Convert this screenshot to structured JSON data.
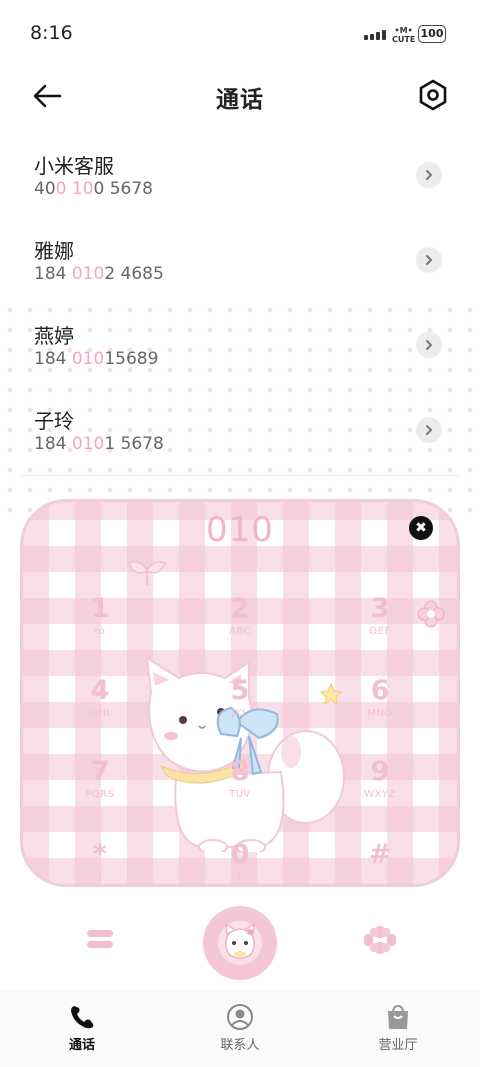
{
  "status_bar": {
    "time": "8:16",
    "carrier_badge": "•M•\nCUTE",
    "battery": "100"
  },
  "header": {
    "title": "通话",
    "back_icon": "arrow-left-icon",
    "settings_icon": "gear-hex-icon"
  },
  "calls": [
    {
      "name": "小米客服",
      "num_a": "40",
      "num_h1": "0",
      "num_b": " ",
      "num_h2": "10",
      "num_c": "0 5678"
    },
    {
      "name": "雅娜",
      "num_a": "184 ",
      "num_h1": "010",
      "num_b": "",
      "num_h2": "",
      "num_c": "2 4685"
    },
    {
      "name": "燕婷",
      "num_a": "184 ",
      "num_h1": "010",
      "num_b": "",
      "num_h2": "",
      "num_c": "15689"
    },
    {
      "name": "子玲",
      "num_a": "184 ",
      "num_h1": "010",
      "num_b": "",
      "num_h2": "",
      "num_c": "1 5678"
    }
  ],
  "dialpad": {
    "input": "010",
    "clear_icon": "close-icon",
    "keys": [
      {
        "digit": "1",
        "letters": "ꝏ"
      },
      {
        "digit": "2",
        "letters": "ABC"
      },
      {
        "digit": "3",
        "letters": "DEF"
      },
      {
        "digit": "4",
        "letters": "GHI"
      },
      {
        "digit": "5",
        "letters": "JKL"
      },
      {
        "digit": "6",
        "letters": "MNO"
      },
      {
        "digit": "7",
        "letters": "PQRS"
      },
      {
        "digit": "8",
        "letters": "TUV"
      },
      {
        "digit": "9",
        "letters": "WXYZ"
      },
      {
        "digit": "*",
        "letters": ","
      },
      {
        "digit": "0",
        "letters": "+"
      },
      {
        "digit": "#",
        "letters": ""
      }
    ]
  },
  "bottom_controls": {
    "menu_icon": "menu-icon",
    "call_icon": "call-avatar-icon",
    "grid_icon": "dialpad-grid-icon"
  },
  "tabs": [
    {
      "label": "通话",
      "icon": "phone-icon",
      "active": true
    },
    {
      "label": "联系人",
      "icon": "contact-icon",
      "active": false
    },
    {
      "label": "营业厅",
      "icon": "shop-bag-icon",
      "active": false
    }
  ],
  "colors": {
    "accent_pink": "#f3a6bd",
    "plaid_pink": "#f2c4d4",
    "call_button": "#f5c7d4"
  }
}
